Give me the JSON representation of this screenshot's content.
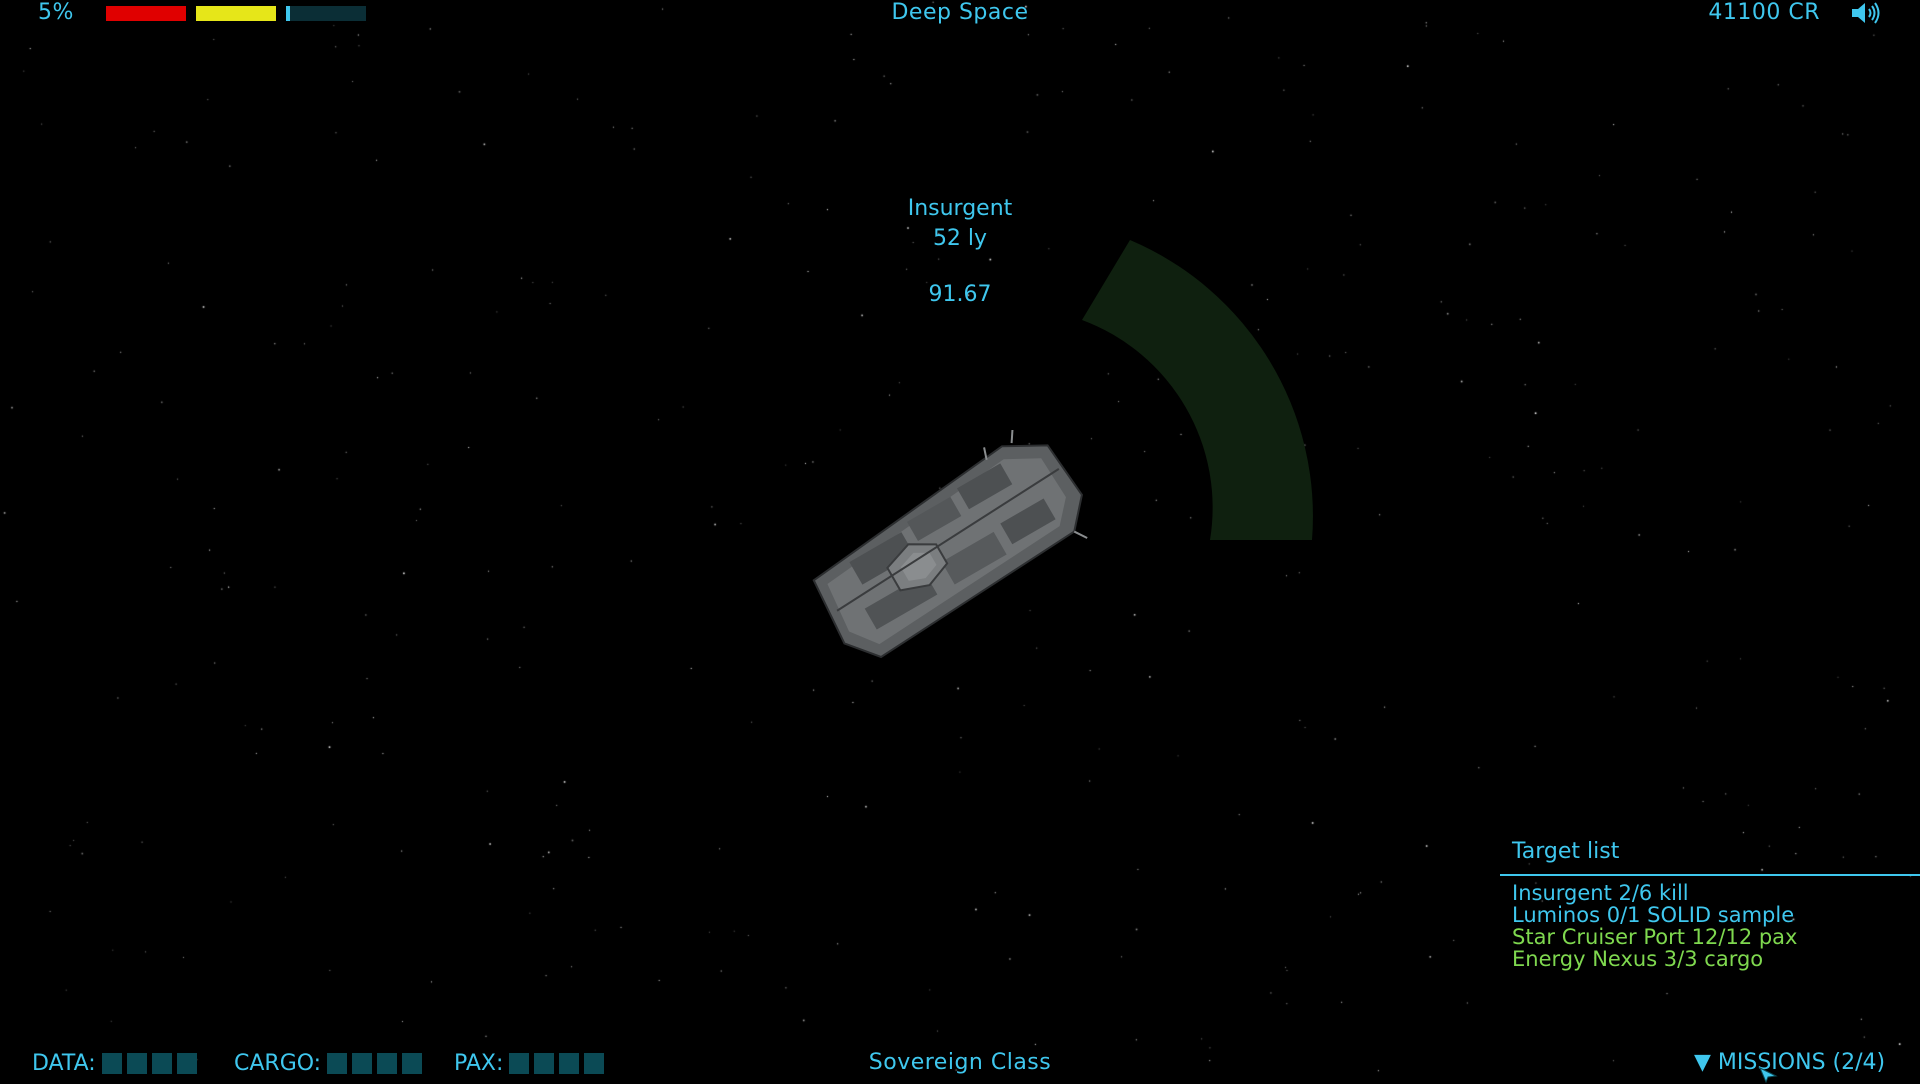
{
  "hud": {
    "hull_percent_label": "5%",
    "bars": {
      "hull": {
        "fill": 1.0,
        "color": "#e00000"
      },
      "shield": {
        "fill": 1.0,
        "color": "#e6e619"
      },
      "energy": {
        "fill": 0.05,
        "color": "#3fc7ee"
      }
    },
    "location": "Deep Space",
    "credits": "41100 CR",
    "sound_icon": "speaker-icon"
  },
  "target": {
    "name": "Insurgent",
    "distance": "52 ly",
    "value": "91.67"
  },
  "target_list": {
    "title": "Target list",
    "items": [
      {
        "text": "Insurgent 2/6 kill",
        "color": "#3fc7ee"
      },
      {
        "text": "Luminos 0/1 SOLID sample",
        "color": "#3fc7ee"
      },
      {
        "text": "Star Cruiser Port 12/12 pax",
        "color": "#7fd84f"
      },
      {
        "text": "Energy Nexus 3/3 cargo",
        "color": "#7fd84f"
      }
    ]
  },
  "bottom": {
    "data_label": "DATA:",
    "cargo_label": "CARGO:",
    "pax_label": "PAX:",
    "ship_class": "Sovereign Class",
    "missions_label": "▼ MISSIONS (2/4)"
  },
  "colors": {
    "hud_text": "#3fc7ee",
    "arc": "#0f200f",
    "slot": "#0b4a55",
    "complete": "#7fd84f"
  }
}
